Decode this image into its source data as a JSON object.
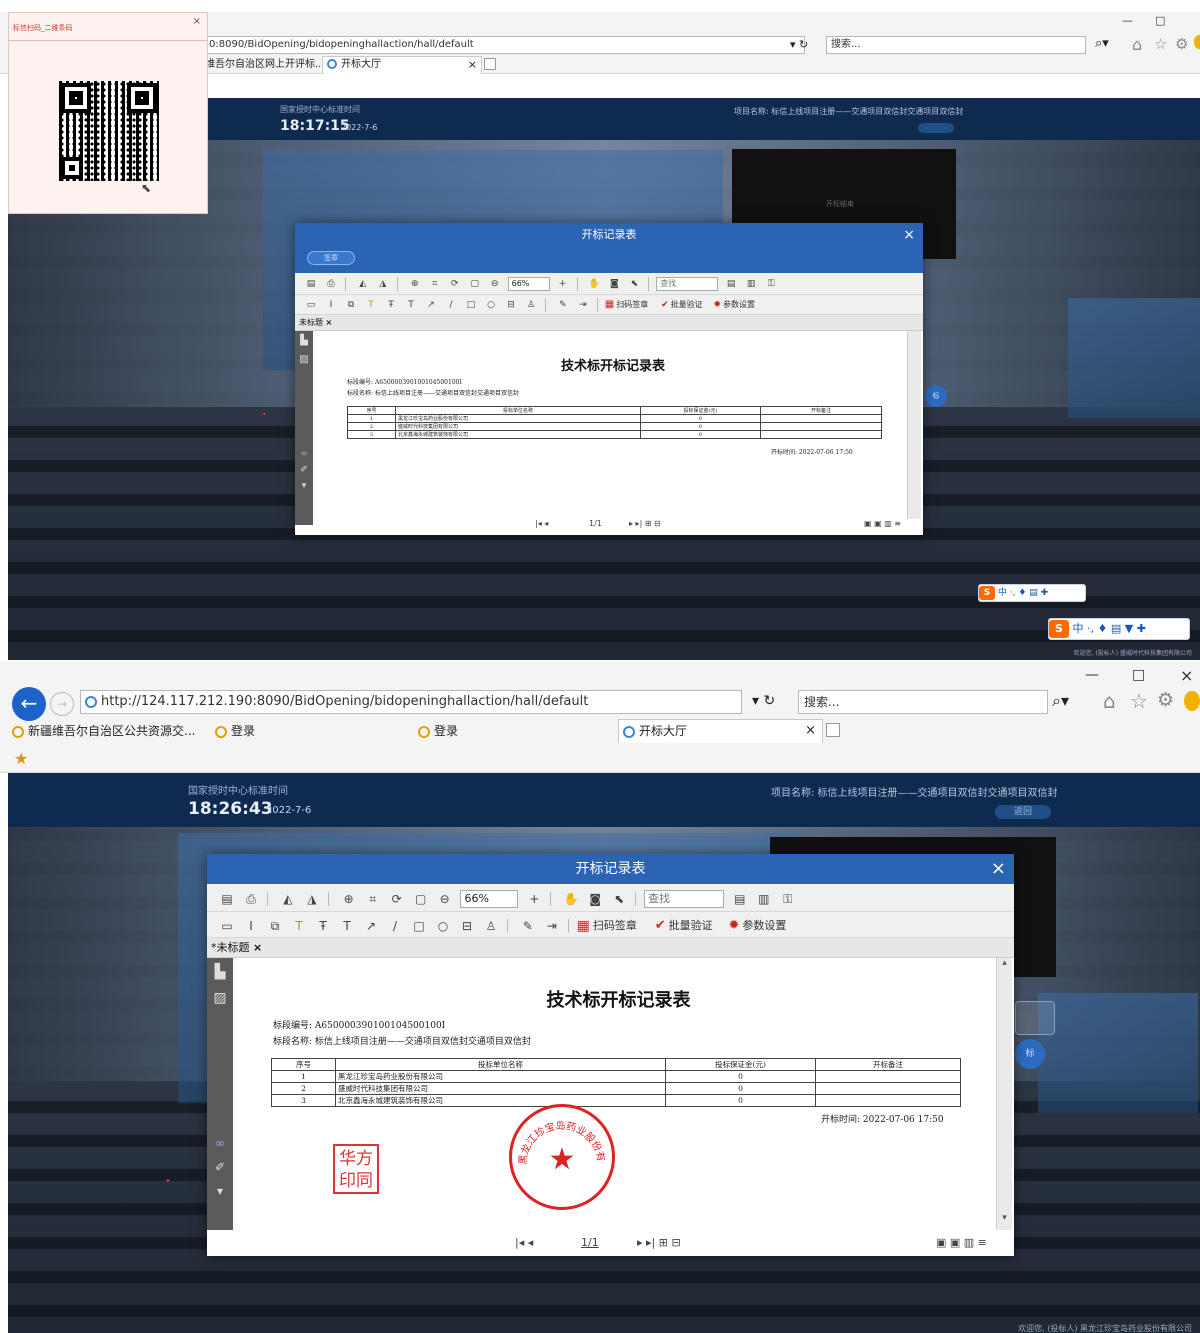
{
  "shot1": {
    "browser": {
      "address": "0:8090/BidOpening/bidopeninghallaction/hall/default",
      "search_placeholder": "搜索...",
      "tabs": [
        {
          "label": "维吾尔自治区网上开评标..."
        },
        {
          "label": "开标大厅"
        }
      ]
    },
    "qr_popup": {
      "title": "标信扫码_二维条码"
    },
    "hall": {
      "time_title": "国家授时中心标准时间",
      "time": "18:17:15",
      "date": "2022-7-6",
      "project": "项目名称: 标信上线项目注册——交通项目双信封交通项目双信封",
      "blackbox_label": "开标结束"
    },
    "dialog": {
      "title": "开标记录表",
      "close": "×",
      "pill": "签章",
      "zoom": "66%",
      "find": "查找",
      "scan_sign": "扫码签章",
      "batch_verify": "批量验证",
      "params": "参数设置",
      "doc_tab": "未标题",
      "page": "1/1"
    },
    "footer": "欢迎您, (投标人) 盛威时代科技集团有限公司",
    "ime": "中"
  },
  "shot2": {
    "browser": {
      "address": "http://124.117.212.190:8090/BidOpening/bidopeninghallaction/hall/default",
      "search_placeholder": "搜索...",
      "tabs": [
        {
          "label": "新疆维吾尔自治区公共资源交..."
        },
        {
          "label": "登录"
        },
        {
          "label": "登录"
        },
        {
          "label": "开标大厅"
        }
      ]
    },
    "hall": {
      "time_title": "国家授时中心标准时间",
      "time": "18:26:43",
      "date": "2022-7-6",
      "project": "项目名称: 标信上线项目注册——交通项目双信封交通项目双信封",
      "return_btn": "返回"
    },
    "dialog": {
      "title": "开标记录表",
      "close": "×",
      "zoom": "66%",
      "find": "查找",
      "scan_sign": "扫码签章",
      "batch_verify": "批量验证",
      "params": "参数设置",
      "doc_tab": "*未标题",
      "page": "1/1"
    },
    "stamp_square": "华方印同",
    "footer": "欢迎您, (投标人) 黑龙江珍宝岛药业股份有限公司"
  },
  "document": {
    "title": "技术标开标记录表",
    "section_no_label": "标段编号:",
    "section_no": "A650000390100104500100I",
    "section_name_label": "标段名称:",
    "section_name": "标信上线项目注册——交通项目双信封交通项目双信封",
    "columns": [
      "序号",
      "投标单位名称",
      "投标保证金(元)",
      "开标备注"
    ],
    "rows": [
      [
        "1",
        "黑龙江珍宝岛药业股份有限公司",
        "0",
        ""
      ],
      [
        "2",
        "盛威时代科技集团有限公司",
        "0",
        ""
      ],
      [
        "3",
        "北京鑫海永城建筑装饰有限公司",
        "0",
        ""
      ]
    ],
    "open_time": "开标时间: 2022-07-06 17:50"
  },
  "colors": {
    "dialog_header": "#2c64b4",
    "hall_topbar": "#0f2a4f",
    "stamp_red": "#d22222"
  }
}
